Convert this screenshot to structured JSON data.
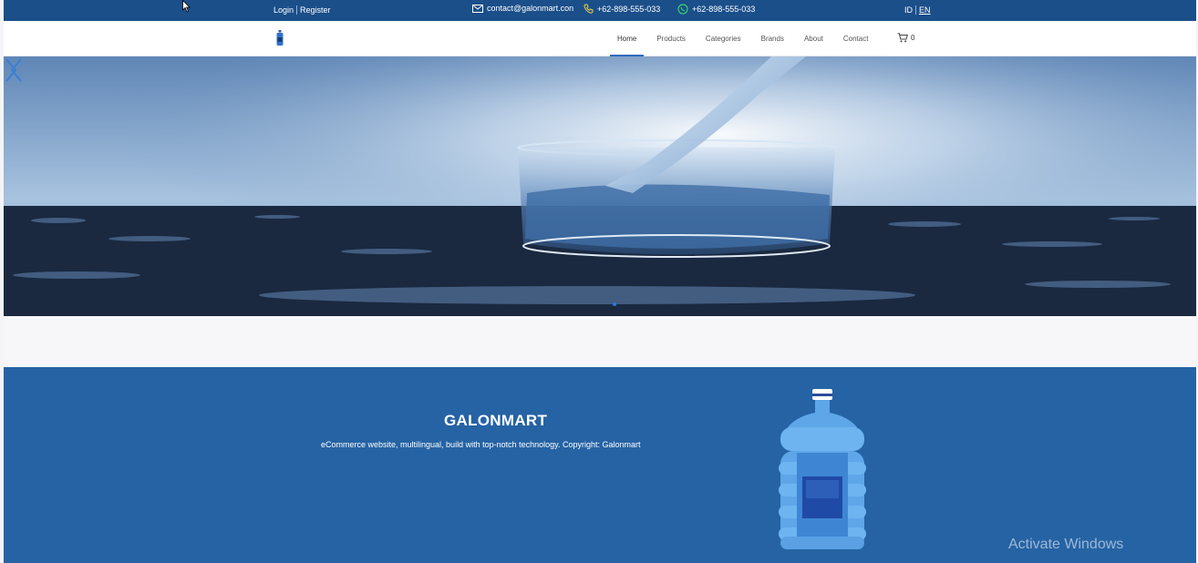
{
  "topbar": {
    "login": "Login",
    "register": "Register",
    "email": "contact@galonmart.con",
    "phone": "+62-898-555-033",
    "whatsapp": "+62-898-555-033",
    "lang_id": "ID",
    "lang_en": "EN",
    "icons": {
      "email": "envelope-icon",
      "phone": "phone-icon",
      "whatsapp": "whatsapp-icon"
    }
  },
  "header": {
    "nav": [
      "Home",
      "Products",
      "Categories",
      "Brands",
      "About",
      "Contact"
    ],
    "active_nav": "Home",
    "cart_count": "0",
    "logo_icon": "water-bottle-logo-icon"
  },
  "hero": {
    "image": "water-pouring-into-glass",
    "prev_icon": "chevron-left-icon",
    "next_icon": "chevron-right-icon"
  },
  "footer": {
    "title": "GALONMART",
    "description": "eCommerce website, multilingual, build with top-notch technology. Copyright: Galonmart",
    "image": "water-gallon-illustration"
  },
  "os": {
    "watermark": "Activate Windows"
  },
  "colors": {
    "topbar": "#1b4f8a",
    "footer": "#2563a4",
    "accent": "#2f6bbd"
  }
}
